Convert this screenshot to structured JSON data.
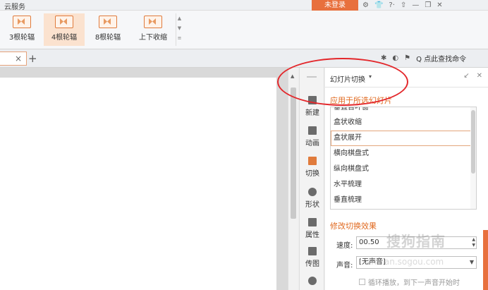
{
  "topbar": {
    "cloud_label": "云服务",
    "login_label": "未登录"
  },
  "ribbon": {
    "items": [
      {
        "label": "3根轮辐"
      },
      {
        "label": "4根轮辐"
      },
      {
        "label": "8根轮辐"
      },
      {
        "label": "上下收缩"
      }
    ],
    "active_index": 1
  },
  "tabstrip": {
    "close_glyph": "×",
    "add_glyph": "+",
    "search_command": "Q 点此查找命令"
  },
  "sidebar": {
    "items": [
      {
        "label": "新建",
        "icon": "new-icon"
      },
      {
        "label": "动画",
        "icon": "animation-icon"
      },
      {
        "label": "切换",
        "icon": "transition-icon"
      },
      {
        "label": "形状",
        "icon": "shape-icon"
      },
      {
        "label": "属性",
        "icon": "property-icon"
      },
      {
        "label": "传图",
        "icon": "upload-image-icon"
      }
    ],
    "active": "切换"
  },
  "panel": {
    "title": "幻灯片切换",
    "apply_section": "应用于所选幻灯片",
    "transitions": [
      "垂直百叶窗",
      "盒状收缩",
      "盒状展开",
      "横向棋盘式",
      "纵向棋盘式",
      "水平梳理",
      "垂直梳理"
    ],
    "selected_transition": "盒状展开",
    "modify_section": "修改切换效果",
    "speed_label": "速度:",
    "speed_value": "00.50",
    "sound_label": "声音:",
    "sound_value": "[无声音]",
    "loop_label": "循环播放，到下一声音开始时"
  },
  "colors": {
    "accent": "#e07b3c",
    "login": "#e8703d",
    "annotation": "#e3272b"
  },
  "watermark": {
    "text": "搜狗指南",
    "sub": "zhinan.sogou.com"
  }
}
